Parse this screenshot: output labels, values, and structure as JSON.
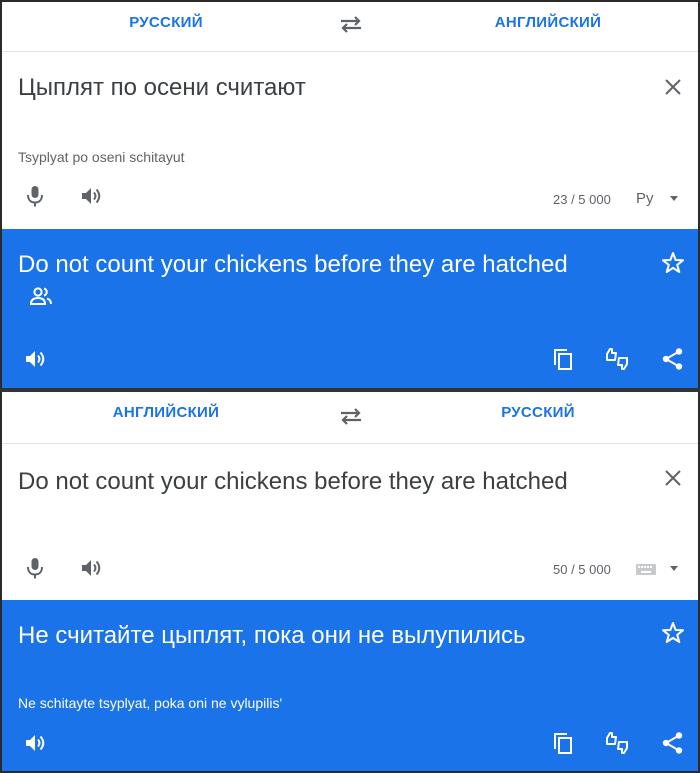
{
  "top": {
    "source_lang": "РУССКИЙ",
    "target_lang": "АНГЛИЙСКИЙ",
    "source_text": "Цыплят по осени считают",
    "transliteration": "Tsyplyat po oseni schitayut",
    "counter": "23 / 5 000",
    "input_tool_label": "Py",
    "translation": "Do not count your chickens before they are hatched"
  },
  "bottom": {
    "source_lang": "АНГЛИЙСКИЙ",
    "target_lang": "РУССКИЙ",
    "source_text": "Do not count your chickens before they are hatched",
    "counter": "50 / 5 000",
    "translation": "Не считайте цыплят, пока они не вылупились",
    "transliteration": "Ne schitayte tsyplyat, poka oni ne vylupilis'"
  },
  "colors": {
    "accent": "#1a73e8",
    "text": "#3c4043",
    "muted": "#5f6368"
  },
  "icons": [
    "swap-icon",
    "close-icon",
    "microphone-icon",
    "speaker-icon",
    "keyboard-icon",
    "star-icon",
    "community-icon",
    "copy-icon",
    "feedback-icon",
    "share-icon"
  ]
}
